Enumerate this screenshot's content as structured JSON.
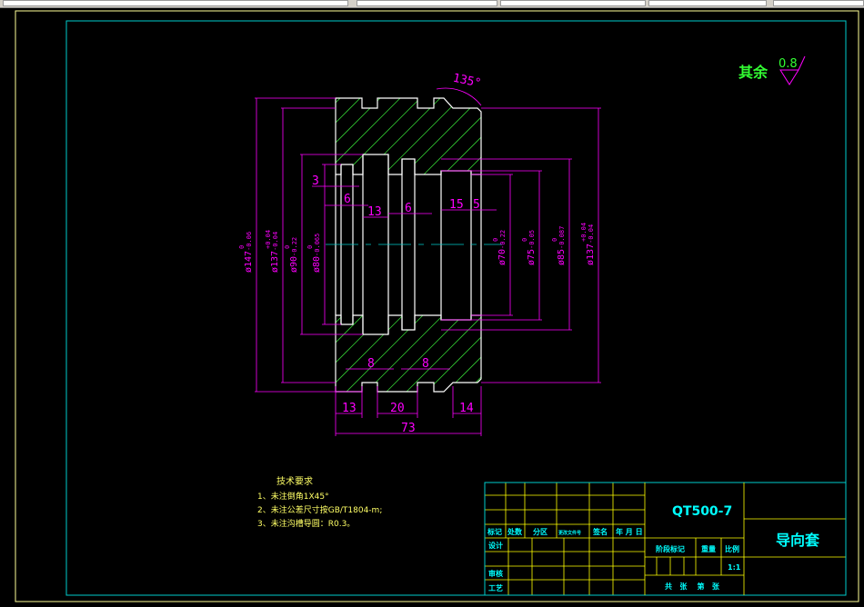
{
  "colors": {
    "background": "#000000",
    "outline": "#ffffff",
    "dimension": "#ff00ff",
    "hatch": "#33cc33",
    "frame_outer": "#ffff99",
    "frame_inner": "#00cccc",
    "title_text": "#00ffff",
    "table_lines": "#ffff00",
    "notes": "#ffff66",
    "roughness": "#33ff33"
  },
  "roughness": {
    "label": "其余",
    "value": "0.8"
  },
  "angle": "135°",
  "diameters": [
    {
      "label": "ø147",
      "upper": "0",
      "lower": "-0.06"
    },
    {
      "label": "ø137",
      "upper": "+0.04",
      "lower": "-0.04"
    },
    {
      "label": "ø90",
      "upper": "0",
      "lower": "-0.22"
    },
    {
      "label": "ø80",
      "upper": "0",
      "lower": "-0.065"
    },
    {
      "label": "ø70",
      "upper": "0",
      "lower": "-0.22"
    },
    {
      "label": "ø75",
      "upper": "0",
      "lower": "-0.05"
    },
    {
      "label": "ø85",
      "upper": "0",
      "lower": "-0.087"
    },
    {
      "label": "ø137",
      "upper": "+0.04",
      "lower": "-0.04"
    }
  ],
  "lengths": [
    "3",
    "6",
    "13",
    "6",
    "15",
    "5",
    "8",
    "8",
    "13",
    "20",
    "14",
    "73"
  ],
  "notes": {
    "title": "技术要求",
    "items": [
      "1、未注倒角1X45°",
      "2、未注公差尺寸按GB/T1804-m;",
      "3、未注沟槽导圆：R0.3。"
    ]
  },
  "title_block": {
    "material": "QT500-7",
    "part_name": "导向套",
    "headers": [
      "标记",
      "处数",
      "分区",
      "更改文件号",
      "签名",
      "年 月 日"
    ],
    "rows": [
      "设计",
      "",
      "审核",
      "工艺"
    ],
    "stage": "阶段标记",
    "weight": "重量",
    "scale_label": "比例",
    "scale": "1:1",
    "sheets": "共   张    第   张"
  }
}
